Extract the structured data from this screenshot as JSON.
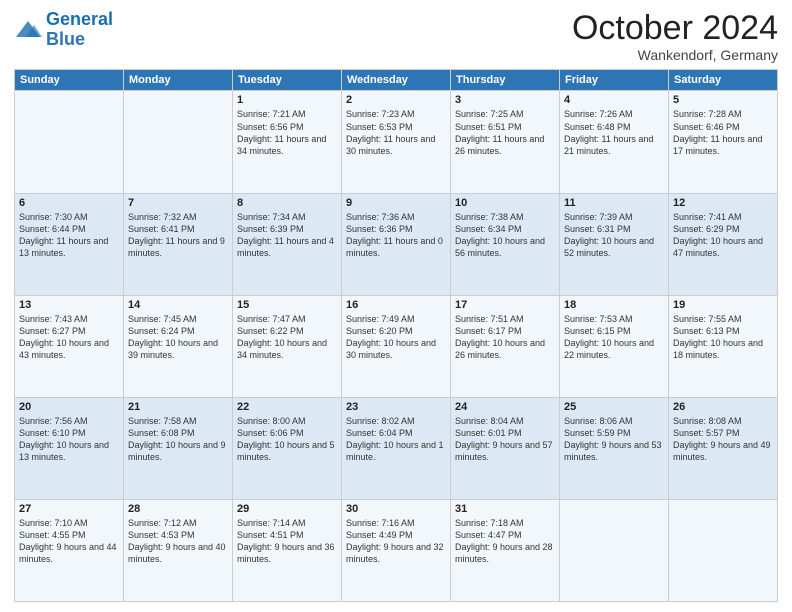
{
  "logo": {
    "line1": "General",
    "line2": "Blue"
  },
  "header": {
    "month": "October 2024",
    "location": "Wankendorf, Germany"
  },
  "weekdays": [
    "Sunday",
    "Monday",
    "Tuesday",
    "Wednesday",
    "Thursday",
    "Friday",
    "Saturday"
  ],
  "weeks": [
    [
      {
        "day": "",
        "sunrise": "",
        "sunset": "",
        "daylight": ""
      },
      {
        "day": "",
        "sunrise": "",
        "sunset": "",
        "daylight": ""
      },
      {
        "day": "1",
        "sunrise": "Sunrise: 7:21 AM",
        "sunset": "Sunset: 6:56 PM",
        "daylight": "Daylight: 11 hours and 34 minutes."
      },
      {
        "day": "2",
        "sunrise": "Sunrise: 7:23 AM",
        "sunset": "Sunset: 6:53 PM",
        "daylight": "Daylight: 11 hours and 30 minutes."
      },
      {
        "day": "3",
        "sunrise": "Sunrise: 7:25 AM",
        "sunset": "Sunset: 6:51 PM",
        "daylight": "Daylight: 11 hours and 26 minutes."
      },
      {
        "day": "4",
        "sunrise": "Sunrise: 7:26 AM",
        "sunset": "Sunset: 6:48 PM",
        "daylight": "Daylight: 11 hours and 21 minutes."
      },
      {
        "day": "5",
        "sunrise": "Sunrise: 7:28 AM",
        "sunset": "Sunset: 6:46 PM",
        "daylight": "Daylight: 11 hours and 17 minutes."
      }
    ],
    [
      {
        "day": "6",
        "sunrise": "Sunrise: 7:30 AM",
        "sunset": "Sunset: 6:44 PM",
        "daylight": "Daylight: 11 hours and 13 minutes."
      },
      {
        "day": "7",
        "sunrise": "Sunrise: 7:32 AM",
        "sunset": "Sunset: 6:41 PM",
        "daylight": "Daylight: 11 hours and 9 minutes."
      },
      {
        "day": "8",
        "sunrise": "Sunrise: 7:34 AM",
        "sunset": "Sunset: 6:39 PM",
        "daylight": "Daylight: 11 hours and 4 minutes."
      },
      {
        "day": "9",
        "sunrise": "Sunrise: 7:36 AM",
        "sunset": "Sunset: 6:36 PM",
        "daylight": "Daylight: 11 hours and 0 minutes."
      },
      {
        "day": "10",
        "sunrise": "Sunrise: 7:38 AM",
        "sunset": "Sunset: 6:34 PM",
        "daylight": "Daylight: 10 hours and 56 minutes."
      },
      {
        "day": "11",
        "sunrise": "Sunrise: 7:39 AM",
        "sunset": "Sunset: 6:31 PM",
        "daylight": "Daylight: 10 hours and 52 minutes."
      },
      {
        "day": "12",
        "sunrise": "Sunrise: 7:41 AM",
        "sunset": "Sunset: 6:29 PM",
        "daylight": "Daylight: 10 hours and 47 minutes."
      }
    ],
    [
      {
        "day": "13",
        "sunrise": "Sunrise: 7:43 AM",
        "sunset": "Sunset: 6:27 PM",
        "daylight": "Daylight: 10 hours and 43 minutes."
      },
      {
        "day": "14",
        "sunrise": "Sunrise: 7:45 AM",
        "sunset": "Sunset: 6:24 PM",
        "daylight": "Daylight: 10 hours and 39 minutes."
      },
      {
        "day": "15",
        "sunrise": "Sunrise: 7:47 AM",
        "sunset": "Sunset: 6:22 PM",
        "daylight": "Daylight: 10 hours and 34 minutes."
      },
      {
        "day": "16",
        "sunrise": "Sunrise: 7:49 AM",
        "sunset": "Sunset: 6:20 PM",
        "daylight": "Daylight: 10 hours and 30 minutes."
      },
      {
        "day": "17",
        "sunrise": "Sunrise: 7:51 AM",
        "sunset": "Sunset: 6:17 PM",
        "daylight": "Daylight: 10 hours and 26 minutes."
      },
      {
        "day": "18",
        "sunrise": "Sunrise: 7:53 AM",
        "sunset": "Sunset: 6:15 PM",
        "daylight": "Daylight: 10 hours and 22 minutes."
      },
      {
        "day": "19",
        "sunrise": "Sunrise: 7:55 AM",
        "sunset": "Sunset: 6:13 PM",
        "daylight": "Daylight: 10 hours and 18 minutes."
      }
    ],
    [
      {
        "day": "20",
        "sunrise": "Sunrise: 7:56 AM",
        "sunset": "Sunset: 6:10 PM",
        "daylight": "Daylight: 10 hours and 13 minutes."
      },
      {
        "day": "21",
        "sunrise": "Sunrise: 7:58 AM",
        "sunset": "Sunset: 6:08 PM",
        "daylight": "Daylight: 10 hours and 9 minutes."
      },
      {
        "day": "22",
        "sunrise": "Sunrise: 8:00 AM",
        "sunset": "Sunset: 6:06 PM",
        "daylight": "Daylight: 10 hours and 5 minutes."
      },
      {
        "day": "23",
        "sunrise": "Sunrise: 8:02 AM",
        "sunset": "Sunset: 6:04 PM",
        "daylight": "Daylight: 10 hours and 1 minute."
      },
      {
        "day": "24",
        "sunrise": "Sunrise: 8:04 AM",
        "sunset": "Sunset: 6:01 PM",
        "daylight": "Daylight: 9 hours and 57 minutes."
      },
      {
        "day": "25",
        "sunrise": "Sunrise: 8:06 AM",
        "sunset": "Sunset: 5:59 PM",
        "daylight": "Daylight: 9 hours and 53 minutes."
      },
      {
        "day": "26",
        "sunrise": "Sunrise: 8:08 AM",
        "sunset": "Sunset: 5:57 PM",
        "daylight": "Daylight: 9 hours and 49 minutes."
      }
    ],
    [
      {
        "day": "27",
        "sunrise": "Sunrise: 7:10 AM",
        "sunset": "Sunset: 4:55 PM",
        "daylight": "Daylight: 9 hours and 44 minutes."
      },
      {
        "day": "28",
        "sunrise": "Sunrise: 7:12 AM",
        "sunset": "Sunset: 4:53 PM",
        "daylight": "Daylight: 9 hours and 40 minutes."
      },
      {
        "day": "29",
        "sunrise": "Sunrise: 7:14 AM",
        "sunset": "Sunset: 4:51 PM",
        "daylight": "Daylight: 9 hours and 36 minutes."
      },
      {
        "day": "30",
        "sunrise": "Sunrise: 7:16 AM",
        "sunset": "Sunset: 4:49 PM",
        "daylight": "Daylight: 9 hours and 32 minutes."
      },
      {
        "day": "31",
        "sunrise": "Sunrise: 7:18 AM",
        "sunset": "Sunset: 4:47 PM",
        "daylight": "Daylight: 9 hours and 28 minutes."
      },
      {
        "day": "",
        "sunrise": "",
        "sunset": "",
        "daylight": ""
      },
      {
        "day": "",
        "sunrise": "",
        "sunset": "",
        "daylight": ""
      }
    ]
  ]
}
